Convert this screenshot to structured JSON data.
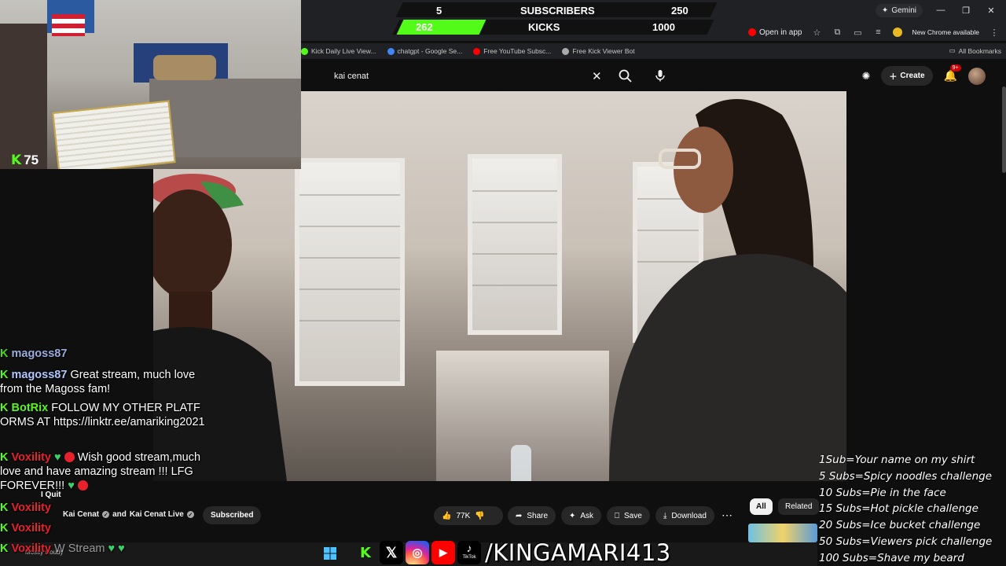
{
  "browser": {
    "gemini_label": "Gemini",
    "open_in_app": "Open in app",
    "new_chrome": "New Chrome available",
    "bookmarks": [
      "Kick Daily Live View...",
      "chatgpt - Google Se...",
      "Free YouTube Subsc...",
      "Free Kick Viewer Bot"
    ],
    "all_bookmarks": "All Bookmarks"
  },
  "counter": {
    "subscribers_current": "5",
    "subscribers_label": "SUBSCRIBERS",
    "subscribers_goal": "250",
    "kicks_current": "262",
    "kicks_label": "KICKS",
    "kicks_goal": "1000",
    "kicks_progress": 0.262
  },
  "youtube": {
    "search_value": "kai cenat",
    "create_label": "Create",
    "notifications": "9+",
    "channel_name": "Kai Cenat",
    "channel_and": "and",
    "channel_second": "Kai Cenat Live",
    "subscribed_label": "Subscribed",
    "likes": "77K",
    "share": "Share",
    "ask": "Ask",
    "save": "Save",
    "download": "Download",
    "chip_all": "All",
    "chip_related": "Related"
  },
  "webcam": {
    "kick_count": "75"
  },
  "chat": {
    "partial_top_user": "magoss87",
    "messages": [
      {
        "user": "magoss87",
        "user_color": "#b1c8ff",
        "text": "Great stream, much love from the Magoss fam!"
      },
      {
        "user": "BotRix",
        "user_color": "#53fc18",
        "text": "FOLLOW MY OTHER PLATFORMS AT https://linktr.ee/amariking2021"
      },
      {
        "user": "Voxility",
        "user_color": "#e8222c",
        "text": "Wish good stream,much love and have amazing stream !!! LFG FOREVER!!!"
      }
    ],
    "repeat_user": "Voxility",
    "quit_label": "I Quit",
    "stream_text": "W Stream",
    "weather": "Mostly cloudy"
  },
  "goals": [
    "1Sub=Your name on my shirt",
    "5 Subs=Spicy noodles challenge",
    "10 Subs=Pie in the face",
    "15 Subs=Hot pickle challenge",
    "20 Subs=Ice bucket challenge",
    "50 Subs=Viewers pick challenge",
    "100 Subs=Shave my beard"
  ],
  "socials": {
    "handle": "/KINGAMARI413",
    "tiktok_label": "TikTok",
    "icons": [
      "kick-icon",
      "x-icon",
      "instagram-icon",
      "youtube-icon",
      "tiktok-icon"
    ]
  },
  "colors": {
    "kick_green": "#53fc18",
    "youtube_red": "#ff0000",
    "chat_heart": "#3ad16b"
  }
}
